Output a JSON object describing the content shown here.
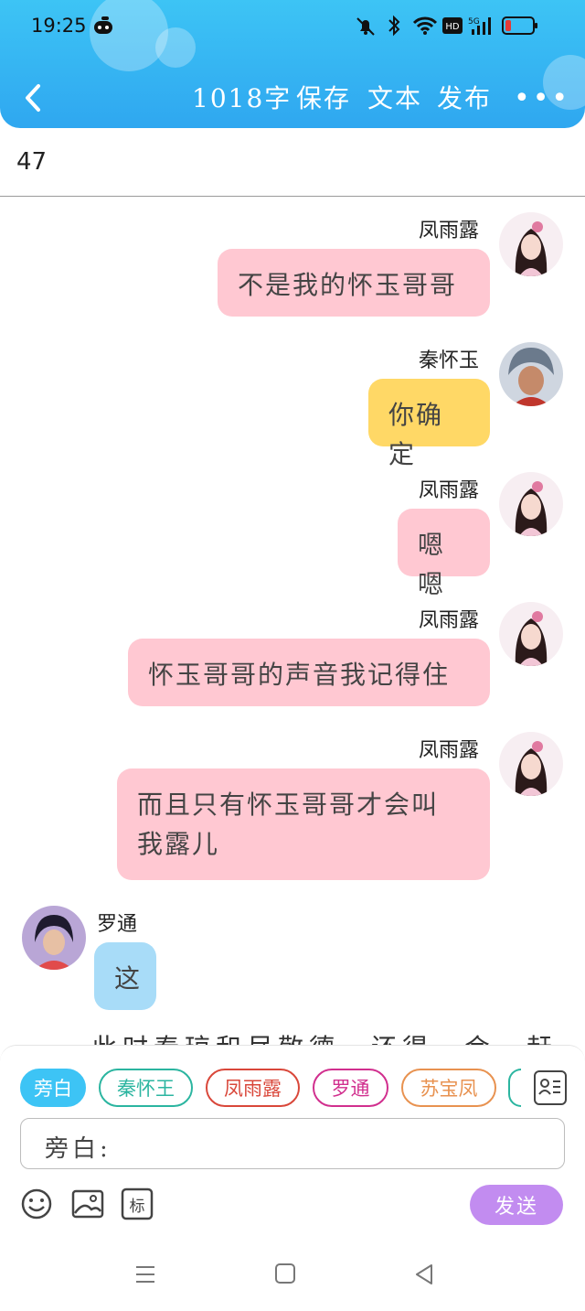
{
  "statusbar": {
    "time": "19:25"
  },
  "toolbar": {
    "word_count": "1018字",
    "save_label": "保存",
    "text_label": "文本",
    "publish_label": "发布",
    "more_label": "•••"
  },
  "episode_number": "47",
  "messages": [
    {
      "speaker": "凤雨露",
      "text": "不是我的怀玉哥哥",
      "side": "right",
      "color": "#ffc8d2"
    },
    {
      "speaker": "秦怀玉",
      "text": "你确定",
      "side": "right",
      "color": "#ffd866"
    },
    {
      "speaker": "凤雨露",
      "text": "嗯嗯",
      "side": "right",
      "color": "#ffc8d2"
    },
    {
      "speaker": "凤雨露",
      "text": "怀玉哥哥的声音我记得住",
      "side": "right",
      "color": "#ffc8d2"
    },
    {
      "speaker": "凤雨露",
      "text_line1": "而且只有怀玉哥哥才会叫",
      "text_line2": "我露儿",
      "side": "right",
      "color": "#ffc8d2"
    },
    {
      "speaker": "罗通",
      "text": "这",
      "side": "left",
      "color": "#a8dcf8"
    }
  ],
  "narration_partial": "此时秦琼和尽敬德…还得一会…赶",
  "roles": [
    {
      "label": "旁白",
      "color": "#3dc4f5"
    },
    {
      "label": "秦怀王",
      "color": "#2bb5a0"
    },
    {
      "label": "凤雨露",
      "color": "#d9473a"
    },
    {
      "label": "罗通",
      "color": "#d12f8e"
    },
    {
      "label": "苏宝凤",
      "color": "#e89250"
    }
  ],
  "input": {
    "label": "旁白:"
  },
  "send_label": "发送",
  "mark_label": "标"
}
